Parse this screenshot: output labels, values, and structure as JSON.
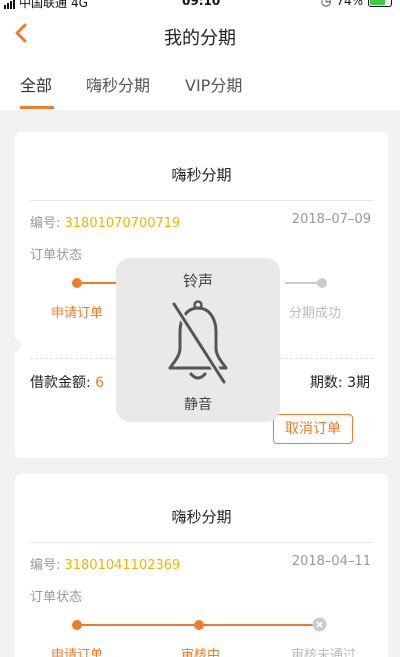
{
  "status_bar": {
    "carrier": "中国联通",
    "network": "4G",
    "time": "09:10",
    "battery": "74%",
    "battery_level": 0.74
  },
  "nav": {
    "title": "我的分期",
    "back_icon": "chevron-left-icon"
  },
  "tabs": [
    {
      "label": "全部",
      "active": true
    },
    {
      "label": "嗨秒分期",
      "active": false
    },
    {
      "label": "VIP分期",
      "active": false
    }
  ],
  "orders": [
    {
      "title": "嗨秒分期",
      "order_label": "编号: ",
      "order_no": "31801070700719",
      "date": "2018–07–09",
      "status_label": "订单状态",
      "steps": [
        "申请订单",
        "分期成功"
      ],
      "amount_label": "借款金额: ",
      "amount_value": "6",
      "periods_label": "期数: ",
      "periods_value": "3期",
      "cancel_label": "取消订单"
    },
    {
      "title": "嗨秒分期",
      "order_label": "编号: ",
      "order_no": "31801041102369",
      "date": "2018–04–11",
      "status_label": "订单状态",
      "steps": [
        "申请订单",
        "审核中",
        "审核未通过"
      ]
    }
  ],
  "overlay": {
    "title": "铃声",
    "subtitle": "静音",
    "icon": "bell-muted-icon"
  },
  "colors": {
    "accent": "#f07c2a",
    "order_no": "#f0b400",
    "inactive": "#cccccc"
  }
}
